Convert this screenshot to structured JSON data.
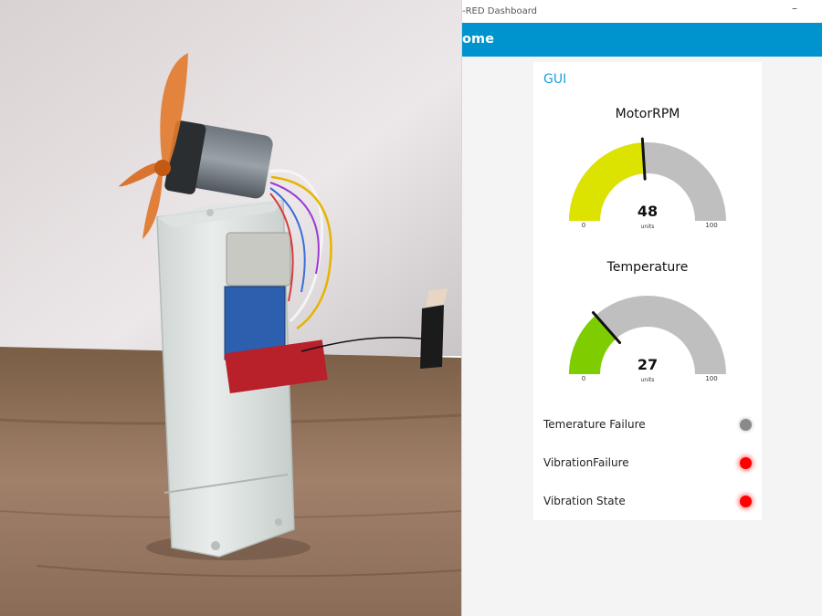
{
  "window": {
    "title": "-RED Dashboard",
    "minimize_glyph": "–"
  },
  "appbar": {
    "page_title": "ome",
    "color": "#0094ce"
  },
  "group": {
    "title": "GUI",
    "title_color": "#1aa0dc"
  },
  "gauges": [
    {
      "title": "MotorRPM",
      "value": 48,
      "value_text": "48",
      "units": "units",
      "min": 0,
      "max": 100,
      "min_label": "0",
      "max_label": "100",
      "fill_color": "#dde300",
      "track_color": "#bfbfbf"
    },
    {
      "title": "Temperature",
      "value": 27,
      "value_text": "27",
      "units": "units",
      "min": 0,
      "max": 100,
      "min_label": "0",
      "max_label": "100",
      "fill_color": "#7dcd00",
      "track_color": "#bfbfbf"
    }
  ],
  "leds": [
    {
      "label": "Temerature Failure",
      "state": "off",
      "color": "#8a8a8a"
    },
    {
      "label": "VibrationFailure",
      "state": "on",
      "color": "#ff0000"
    },
    {
      "label": "Vibration State",
      "state": "on",
      "color": "#ff0000"
    }
  ],
  "photo": {
    "subject": "fan-motor-prototype-on-enclosure"
  }
}
